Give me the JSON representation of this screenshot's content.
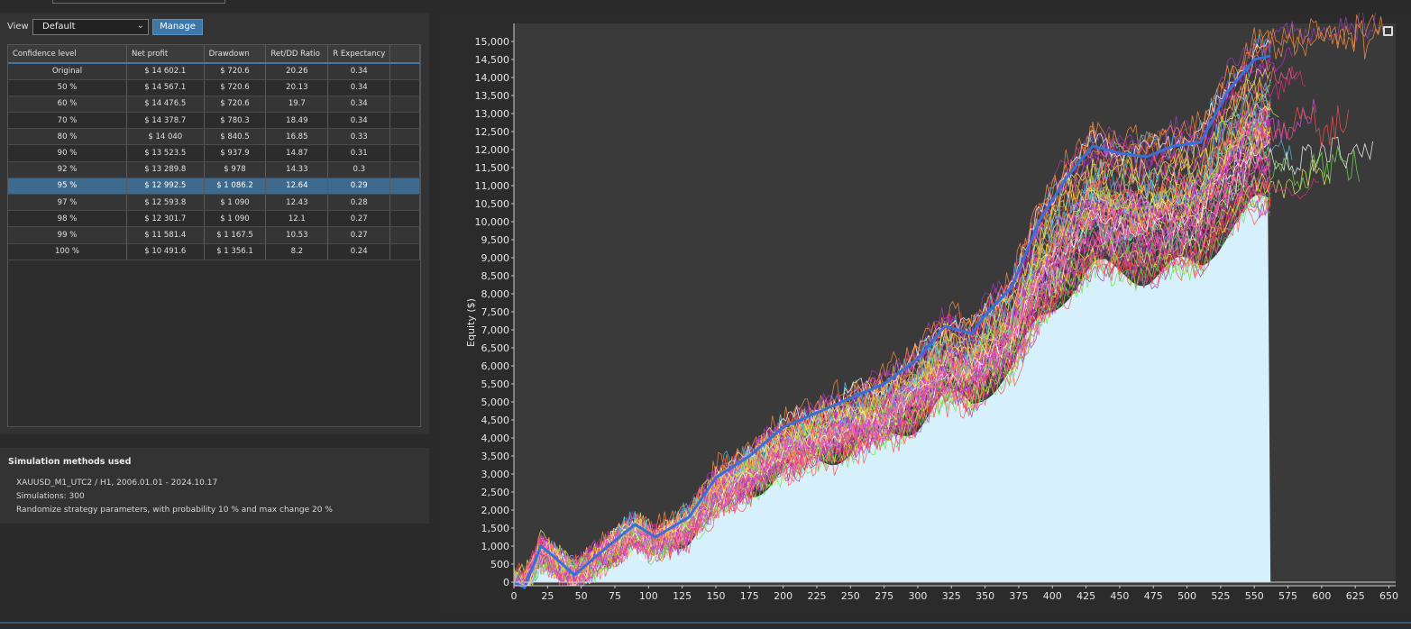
{
  "toolbar": {
    "view_label": "View",
    "view_value": "Default",
    "manage_label": "Manage"
  },
  "table": {
    "headers": [
      "Confidence level",
      "Net profit",
      "Drawdown",
      "Ret/DD Ratio",
      "R Expectancy"
    ],
    "rows": [
      [
        "Original",
        "$ 14 602.1",
        "$ 720.6",
        "20.26",
        "0.34"
      ],
      [
        "50 %",
        "$ 14 567.1",
        "$ 720.6",
        "20.13",
        "0.34"
      ],
      [
        "60 %",
        "$ 14 476.5",
        "$ 720.6",
        "19.7",
        "0.34"
      ],
      [
        "70 %",
        "$ 14 378.7",
        "$ 780.3",
        "18.49",
        "0.34"
      ],
      [
        "80 %",
        "$ 14 040",
        "$ 840.5",
        "16.85",
        "0.33"
      ],
      [
        "90 %",
        "$ 13 523.5",
        "$ 937.9",
        "14.87",
        "0.31"
      ],
      [
        "92 %",
        "$ 13 289.8",
        "$ 978",
        "14.33",
        "0.3"
      ],
      [
        "95 %",
        "$ 12 992.5",
        "$ 1 086.2",
        "12.64",
        "0.29"
      ],
      [
        "97 %",
        "$ 12 593.8",
        "$ 1 090",
        "12.43",
        "0.28"
      ],
      [
        "98 %",
        "$ 12 301.7",
        "$ 1 090",
        "12.1",
        "0.27"
      ],
      [
        "99 %",
        "$ 11 581.4",
        "$ 1 167.5",
        "10.53",
        "0.27"
      ],
      [
        "100 %",
        "$ 10 491.6",
        "$ 1 356.1",
        "8.2",
        "0.24"
      ]
    ],
    "selected_row": 7
  },
  "simulation": {
    "title": "Simulation methods used",
    "lines": [
      "XAUUSD_M1_UTC2 / H1, 2006.01.01 - 2024.10.17",
      "Simulations: 300",
      "Randomize strategy parameters, with probability 10 % and max change 20 %"
    ]
  },
  "chart_data": {
    "type": "line",
    "ylabel": "Equity ($)",
    "xlabel": "",
    "xlim": [
      0,
      655
    ],
    "ylim": [
      -100,
      15500
    ],
    "x_ticks": [
      0,
      25,
      50,
      75,
      100,
      125,
      150,
      175,
      200,
      225,
      250,
      275,
      300,
      325,
      350,
      375,
      400,
      425,
      450,
      475,
      500,
      525,
      550,
      575,
      600,
      625,
      650
    ],
    "y_ticks": [
      0,
      500,
      1000,
      1500,
      2000,
      2500,
      3000,
      3500,
      4000,
      4500,
      5000,
      5500,
      6000,
      6500,
      7000,
      7500,
      8000,
      8500,
      9000,
      9500,
      10000,
      10500,
      11000,
      11500,
      12000,
      12500,
      13000,
      13500,
      14000,
      14500,
      15000
    ],
    "fill_end_x": 562,
    "main_series": {
      "name": "Original",
      "color": "#3a6fd8",
      "points": [
        [
          0,
          0
        ],
        [
          8,
          -150
        ],
        [
          20,
          1000
        ],
        [
          30,
          700
        ],
        [
          45,
          200
        ],
        [
          70,
          1000
        ],
        [
          90,
          1600
        ],
        [
          105,
          1250
        ],
        [
          130,
          1800
        ],
        [
          150,
          2900
        ],
        [
          175,
          3500
        ],
        [
          200,
          4300
        ],
        [
          225,
          4700
        ],
        [
          250,
          5100
        ],
        [
          275,
          5500
        ],
        [
          300,
          6200
        ],
        [
          320,
          7100
        ],
        [
          340,
          6900
        ],
        [
          350,
          7400
        ],
        [
          370,
          8200
        ],
        [
          390,
          10000
        ],
        [
          410,
          11200
        ],
        [
          430,
          12100
        ],
        [
          450,
          11900
        ],
        [
          470,
          11800
        ],
        [
          490,
          12100
        ],
        [
          510,
          12200
        ],
        [
          530,
          13600
        ],
        [
          550,
          14500
        ],
        [
          562,
          14600
        ]
      ]
    },
    "band_colors": [
      "#e0307a",
      "#c030c8",
      "#ff5050",
      "#e8e040",
      "#70e050",
      "#ff9040",
      "#d050e0",
      "#f0f060",
      "#ff6090",
      "#a040c0",
      "#50c0e0",
      "#ffffff"
    ],
    "fill_color": "#d6f0fc"
  }
}
